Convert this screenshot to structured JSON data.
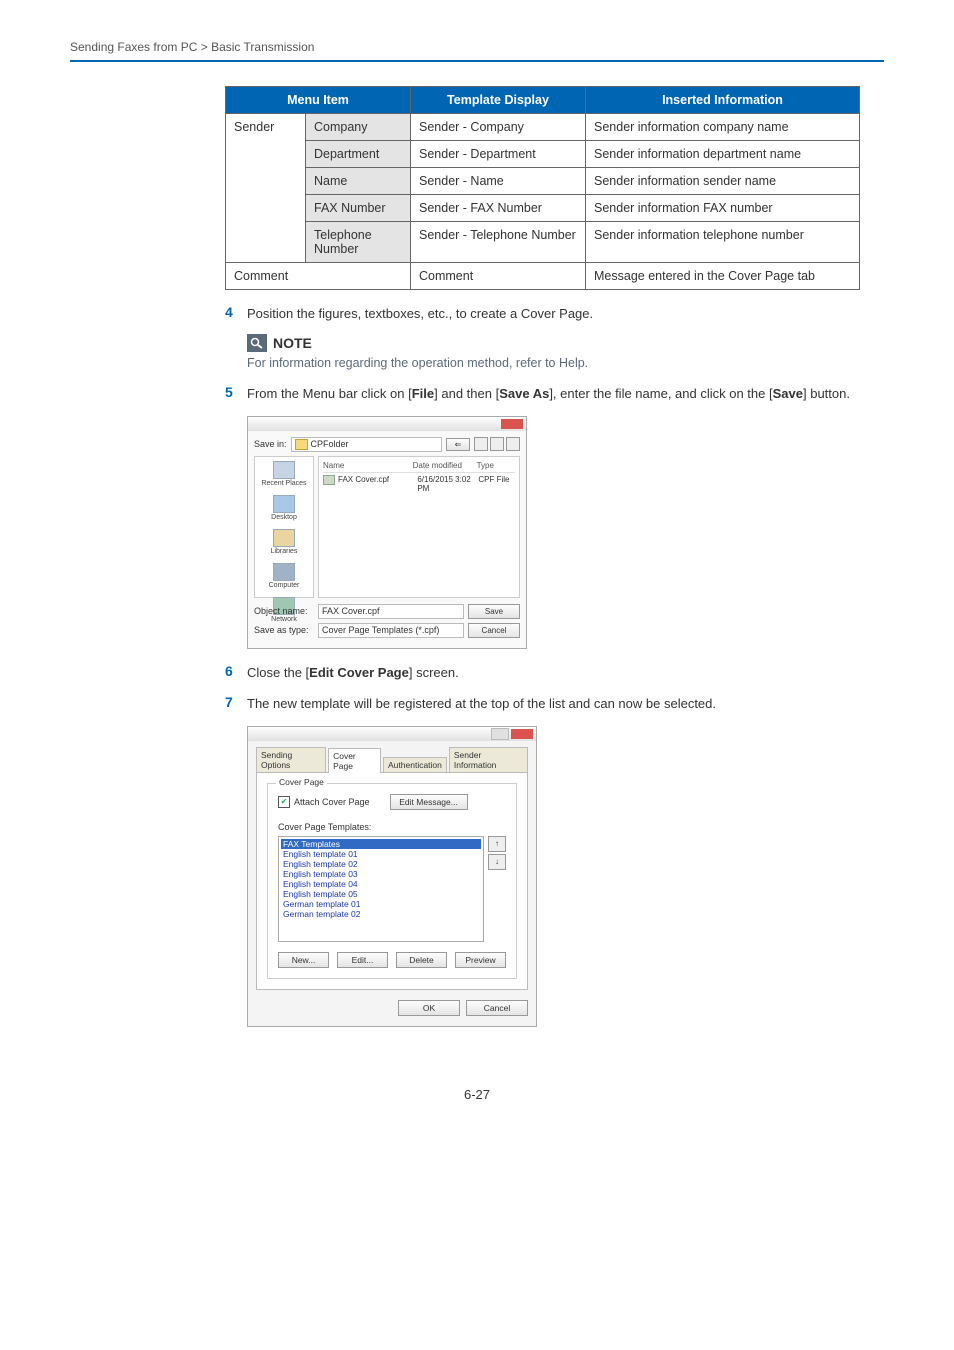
{
  "breadcrumb": "Sending Faxes from PC > Basic Transmission",
  "table": {
    "headers": {
      "menu": "Menu Item",
      "template": "Template Display",
      "inserted": "Inserted Information"
    },
    "senderLabel": "Sender",
    "rows": [
      {
        "sub": "Company",
        "template": "Sender - Company",
        "inserted": "Sender information company name"
      },
      {
        "sub": "Department",
        "template": "Sender - Department",
        "inserted": "Sender information department name"
      },
      {
        "sub": "Name",
        "template": "Sender - Name",
        "inserted": "Sender information sender name"
      },
      {
        "sub": "FAX Number",
        "template": "Sender - FAX Number",
        "inserted": "Sender information FAX number"
      },
      {
        "sub": "Telephone Number",
        "template": "Sender - Telephone Number",
        "inserted": "Sender information telephone number"
      }
    ],
    "commentRow": {
      "label": "Comment",
      "template": "Comment",
      "inserted": "Message entered in the Cover Page tab"
    }
  },
  "steps": {
    "s4": {
      "num": "4",
      "text": "Position the figures, textboxes, etc., to create a Cover Page."
    },
    "s5": {
      "num": "5",
      "pre": "From the Menu bar click on [",
      "b1": "File",
      "mid1": "] and then [",
      "b2": "Save As",
      "mid2": "], enter the file name, and click on the [",
      "b3": "Save",
      "post": "] button."
    },
    "s6": {
      "num": "6",
      "pre": "Close the [",
      "b1": "Edit Cover Page",
      "post": "] screen."
    },
    "s7": {
      "num": "7",
      "text": "The new template will be registered at the top of the list and can now be selected."
    }
  },
  "note": {
    "label": "NOTE",
    "text": "For information regarding the operation method, refer to Help."
  },
  "saveDialog": {
    "saveInLabel": "Save in:",
    "folder": "CPFolder",
    "listHead": {
      "name": "Name",
      "date": "Date modified",
      "type": "Type"
    },
    "fileRow": {
      "name": "FAX Cover.cpf",
      "date": "6/16/2015 3:02 PM",
      "type": "CPF File"
    },
    "side": [
      "Recent Places",
      "Desktop",
      "Libraries",
      "Computer",
      "Network"
    ],
    "objectNameLabel": "Object name:",
    "objectName": "FAX Cover.cpf",
    "saveTypeLabel": "Save as type:",
    "saveType": "Cover Page Templates (*.cpf)",
    "save": "Save",
    "cancel": "Cancel"
  },
  "settingsDialog": {
    "tabs": [
      "Sending Options",
      "Cover Page",
      "Authentication",
      "Sender Information"
    ],
    "groupTitle": "Cover Page",
    "attach": "Attach Cover Page",
    "editMsg": "Edit Message...",
    "tplLabel": "Cover Page Templates:",
    "templates": [
      "FAX Templates",
      "English template 01",
      "English template 02",
      "English template 03",
      "English template 04",
      "English template 05",
      "German template 01",
      "German template 02"
    ],
    "btns": {
      "new": "New...",
      "edit": "Edit...",
      "delete": "Delete",
      "preview": "Preview"
    },
    "ok": "OK",
    "cancel": "Cancel"
  },
  "pageNum": "6-27"
}
